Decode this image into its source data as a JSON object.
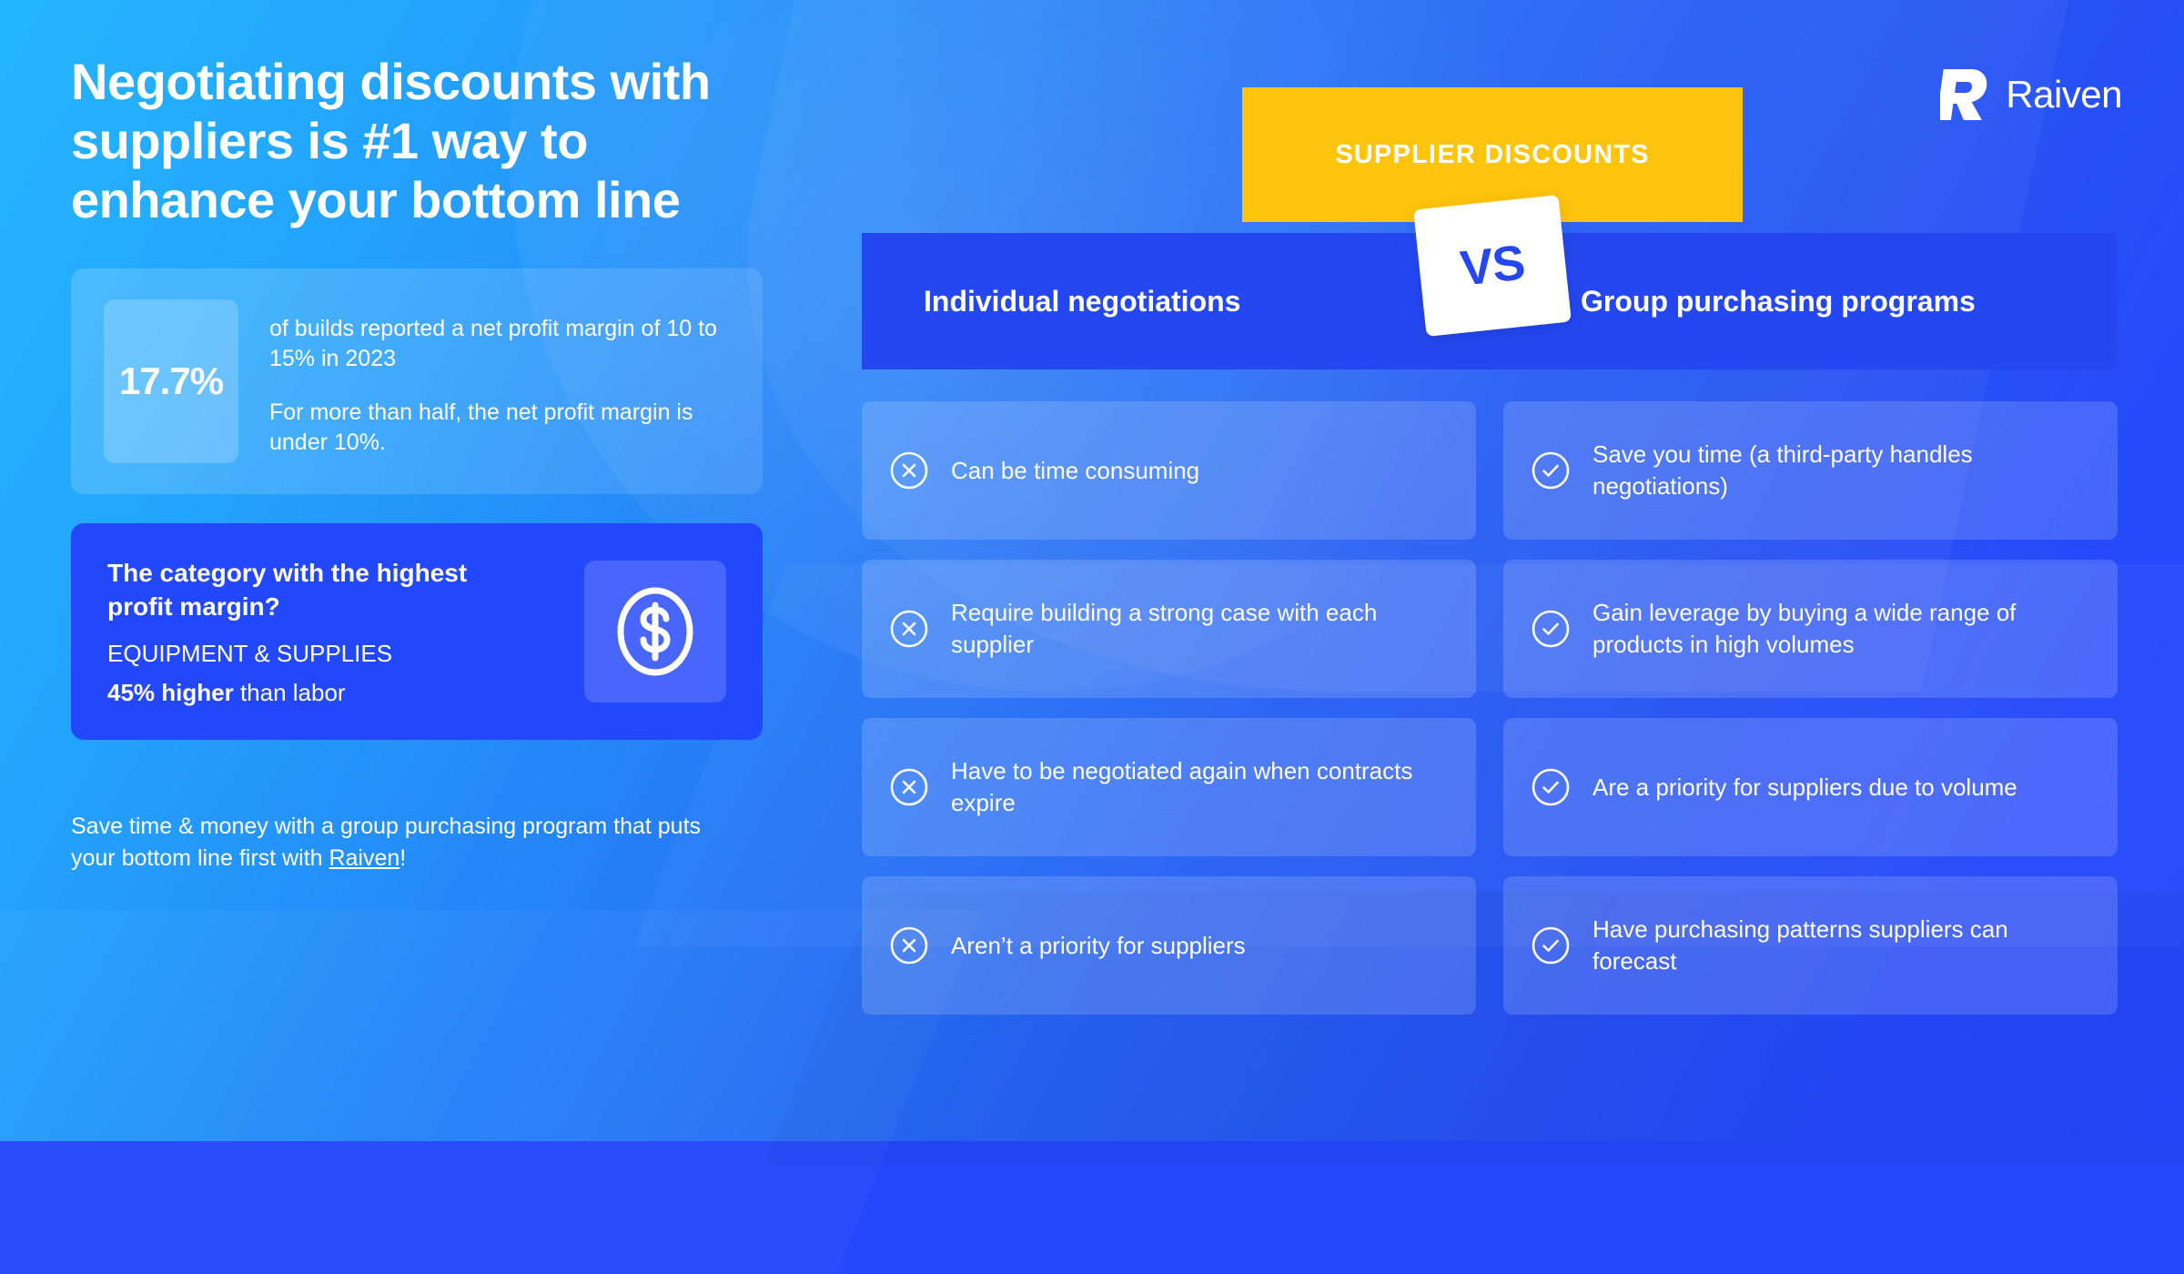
{
  "headline": "Negotiating discounts with suppliers is #1 way to enhance your bottom line",
  "stat_card": {
    "percent": "17.7%",
    "line1": "of builds reported a net profit margin of 10 to 15% in 2023",
    "line2": "For more than half, the net profit margin is under 10%."
  },
  "category_card": {
    "question": "The category with the highest profit margin?",
    "answer": "EQUIPMENT & SUPPLIES",
    "note_bold": "45% higher",
    "note_rest": " than labor",
    "icon": "dollar-circle-icon"
  },
  "footer": {
    "text_before": "Save time & money with a group purchasing program that puts your bottom line first with ",
    "link": "Raiven",
    "text_after": "!"
  },
  "brand": {
    "name": "Raiven",
    "logo_icon": "raiven-r-mark"
  },
  "badge": {
    "label": "SUPPLIER DISCOUNTS",
    "color": "#FFC40C"
  },
  "comparison_header": {
    "left_label": "Individual negotiations",
    "vs_label": "VS",
    "right_label": "Group purchasing programs",
    "bar_color": "#2447F0"
  },
  "rows": [
    {
      "con": {
        "icon": "x-circle-icon",
        "text": "Can be time consuming"
      },
      "pro": {
        "icon": "check-circle-icon",
        "text": "Save you time (a third-party handles negotiations)"
      }
    },
    {
      "con": {
        "icon": "x-circle-icon",
        "text": "Require building a strong case with each supplier"
      },
      "pro": {
        "icon": "check-circle-icon",
        "text": "Gain leverage by buying a wide range of products in high volumes"
      }
    },
    {
      "con": {
        "icon": "x-circle-icon",
        "text": "Have to be negotiated again when contracts expire"
      },
      "pro": {
        "icon": "check-circle-icon",
        "text": "Are a priority for suppliers due to volume"
      }
    },
    {
      "con": {
        "icon": "x-circle-icon",
        "text": "Aren’t a priority for suppliers"
      },
      "pro": {
        "icon": "check-circle-icon",
        "text": "Have purchasing patterns suppliers can forecast"
      }
    }
  ],
  "colors": {
    "bg_start": "#25B5FE",
    "bg_end": "#2346FB",
    "accent_yellow": "#FFC40C",
    "header_blue": "#2447F0",
    "card_blue": "#2348FB"
  }
}
